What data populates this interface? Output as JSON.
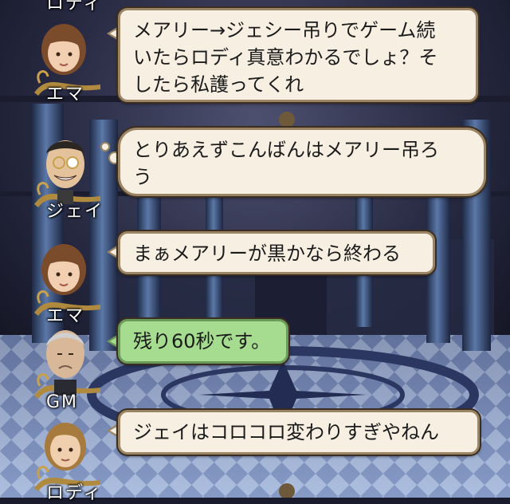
{
  "top_partial_name": "ロディ",
  "messages": [
    {
      "speaker": "エマ",
      "text": "メアリー→ジェシー吊りでゲーム続\nいたらロディ真意わかるでしょ？そ\nしたら私護ってくれ",
      "style": "speech"
    },
    {
      "speaker": "ジェイ",
      "text": "とりあえずこんばんはメアリー吊ろ\nう",
      "style": "thought"
    },
    {
      "speaker": "エマ",
      "text": "まぁメアリーが黒かなら終わる",
      "style": "speech"
    },
    {
      "speaker": "GM",
      "text": "残り60秒です。",
      "style": "system"
    },
    {
      "speaker": "ロディ",
      "text": "ジェイはコロコロ変わりすぎやねん",
      "style": "speech"
    }
  ],
  "colors": {
    "bubble": "#f6efe2",
    "bubble_border": "#9b8564",
    "system_bubble": "#a5dc8f"
  }
}
